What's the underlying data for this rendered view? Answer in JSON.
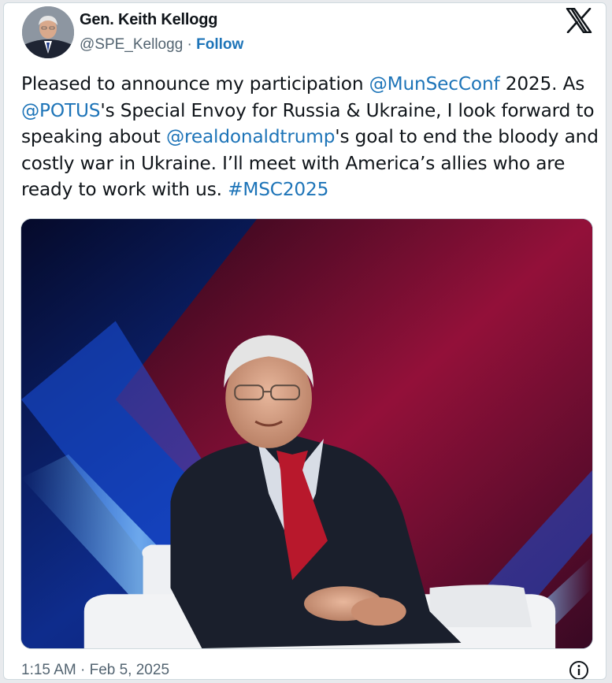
{
  "author": {
    "display_name": "Gen. Keith Kellogg",
    "handle": "@SPE_Kellogg",
    "separator": " · ",
    "follow_label": "Follow"
  },
  "brand": {
    "logo_icon": "x-logo-icon"
  },
  "tweet": {
    "segments": [
      {
        "type": "text",
        "value": "Pleased to announce my participation "
      },
      {
        "type": "mention",
        "value": "@MunSecConf"
      },
      {
        "type": "text",
        "value": " 2025. As "
      },
      {
        "type": "mention",
        "value": "@POTUS"
      },
      {
        "type": "text",
        "value": "'s Special Envoy for Russia & Ukraine, I look forward to speaking about "
      },
      {
        "type": "mention",
        "value": "@realdonaldtrump"
      },
      {
        "type": "text",
        "value": "'s goal to end the bloody and costly war in Ukraine. I’ll meet with America’s allies who are ready to work with us. "
      },
      {
        "type": "hashtag",
        "value": "#MSC2025"
      }
    ]
  },
  "media": {
    "description_icon": "photo",
    "background_colors": {
      "left": "#0c2a8a",
      "right": "#8a0d2e",
      "streak": "#2f7bff"
    }
  },
  "footer": {
    "timestamp": "1:15 AM · Feb 5, 2025",
    "info_icon": "info-icon"
  },
  "colors": {
    "link": "#1d74b8",
    "text": "#0f1419",
    "muted": "#536471"
  }
}
